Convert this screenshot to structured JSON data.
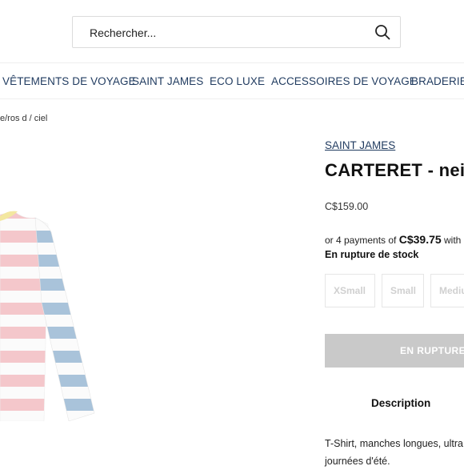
{
  "search": {
    "placeholder": "Rechercher..."
  },
  "nav": {
    "items": [
      {
        "label": "VÊTEMENTS DE VOYAGE"
      },
      {
        "label": "SAINT JAMES"
      },
      {
        "label": "ECO LUXE"
      },
      {
        "label": "ACCESSOIRES DE VOYAGE"
      },
      {
        "label": "BRADERIE"
      }
    ]
  },
  "breadcrumb": "e/ros d / ciel",
  "product": {
    "brand": "SAINT JAMES",
    "title": "CARTERET - neig",
    "price": "C$159.00",
    "installments_prefix": "or 4 payments of ",
    "installments_amount": "C$39.75",
    "installments_suffix": " with",
    "stock_status": "En rupture de stock",
    "sizes": [
      "XSmall",
      "Small",
      "Mediu"
    ],
    "out_of_stock_label": "EN RUPTURE",
    "description_tab": "Description",
    "description_line1": "T-Shirt, manches longues, ultra",
    "description_line2": "journées d'été."
  },
  "colors": {
    "link": "#1f3a5f",
    "stripe_pink": "#f4c7cb",
    "stripe_blue": "#a9c3da",
    "button_disabled": "#c9c9c9"
  }
}
